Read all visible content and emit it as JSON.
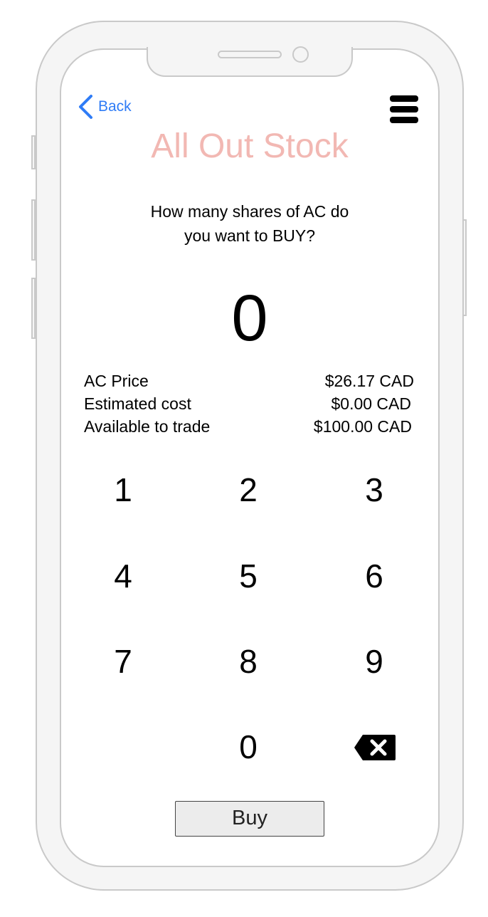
{
  "header": {
    "back_label": "Back",
    "menu_icon": "hamburger-menu-icon",
    "back_icon": "chevron-left-icon",
    "accent_color": "#2f7cf6"
  },
  "title": {
    "text": "All Out Stock",
    "color": "#f2b8b3"
  },
  "question": {
    "line1": "How many shares of AC do",
    "line2": "you want to BUY?"
  },
  "amount": "0",
  "info": {
    "rows": [
      {
        "label": "AC Price",
        "value": "$26.17 CAD"
      },
      {
        "label": "Estimated cost",
        "value": "$0.00 CAD"
      },
      {
        "label": "Available to trade",
        "value": "$100.00 CAD"
      }
    ]
  },
  "keypad": {
    "keys": [
      "1",
      "2",
      "3",
      "4",
      "5",
      "6",
      "7",
      "8",
      "9",
      "0"
    ],
    "backspace_icon": "backspace-icon"
  },
  "buy_button": {
    "label": "Buy"
  }
}
